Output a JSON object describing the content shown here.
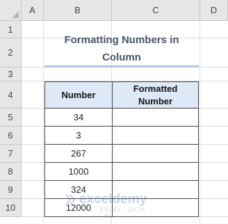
{
  "spreadsheet": {
    "columns": [
      "A",
      "B",
      "C",
      "D"
    ],
    "rows": [
      "1",
      "2",
      "3",
      "4",
      "5",
      "6",
      "7",
      "8",
      "9",
      "10"
    ]
  },
  "title": {
    "line1": "Formatting Numbers in",
    "line2": "Column"
  },
  "table": {
    "headers": {
      "number": "Number",
      "formatted_line1": "Formatted",
      "formatted_line2": "Number"
    },
    "values": [
      "34",
      "3",
      "267",
      "1000",
      "324",
      "12000"
    ],
    "formatted": [
      "",
      "",
      "",
      "",
      "",
      ""
    ]
  },
  "watermark": {
    "name": "exceldemy",
    "tagline": "EXCEL · DATA · BI",
    "icon": "exceldemy-logo-icon"
  },
  "colors": {
    "header_bg": "#e6e6e6",
    "table_header_bg": "#dde9f6",
    "title_color": "#44546a",
    "title_rule": "#aec6e2"
  }
}
